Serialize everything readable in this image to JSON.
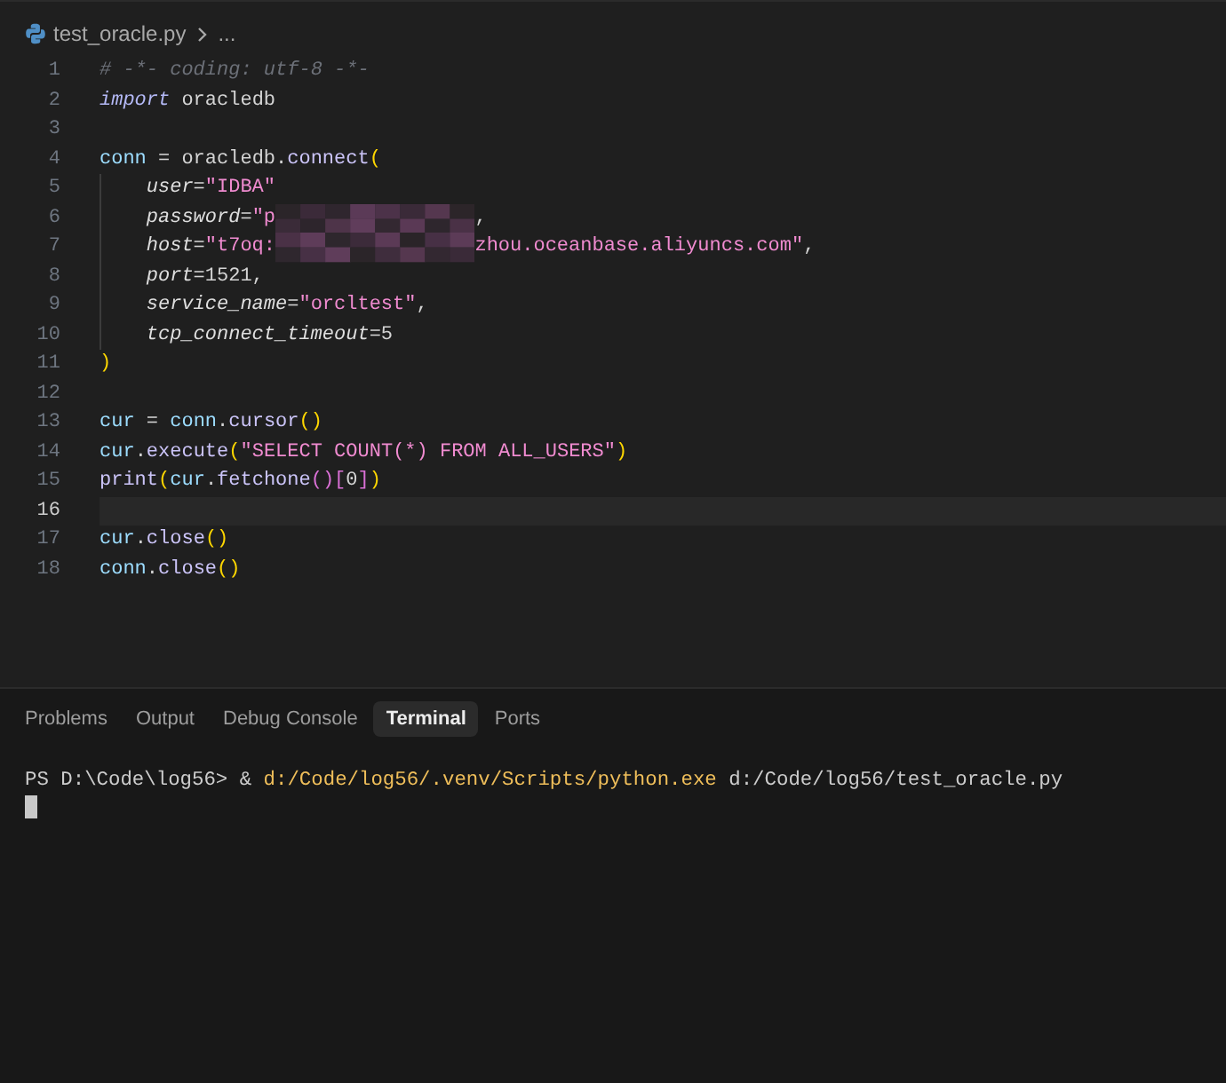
{
  "breadcrumb": {
    "file": "test_oracle.py",
    "more": "..."
  },
  "code": {
    "lines": [
      {
        "number": "1",
        "current": false,
        "tokens": [
          {
            "kind": "comment",
            "text": "# -*- coding: utf-8 -*-"
          }
        ]
      },
      {
        "number": "2",
        "current": false,
        "tokens": [
          {
            "kind": "keyword",
            "text": "import"
          },
          {
            "kind": "plain",
            "text": " oracledb"
          }
        ]
      },
      {
        "number": "3",
        "current": false
      },
      {
        "number": "4",
        "current": false,
        "tokens": [
          {
            "kind": "variable",
            "text": "conn"
          },
          {
            "kind": "plain",
            "text": " = oracledb."
          },
          {
            "kind": "function",
            "text": "connect"
          },
          {
            "kind": "bracket",
            "text": "("
          }
        ],
        "children": [
          {
            "number": "5",
            "current": false,
            "tokens": [
              {
                "kind": "param",
                "text": "user"
              },
              {
                "kind": "plain",
                "text": "="
              },
              {
                "kind": "string",
                "text": "\"IDBA\""
              }
            ]
          },
          {
            "number": "6",
            "current": false,
            "tokens": [
              {
                "kind": "param",
                "text": "password"
              },
              {
                "kind": "plain",
                "text": "="
              },
              {
                "kind": "string",
                "text": "\"p"
              },
              {
                "kind": "redacted"
              },
              {
                "kind": "plain",
                "text": ","
              }
            ]
          },
          {
            "number": "7",
            "current": false,
            "tokens": [
              {
                "kind": "param",
                "text": "host"
              },
              {
                "kind": "plain",
                "text": "="
              },
              {
                "kind": "string",
                "text": "\"t7oq:"
              },
              {
                "kind": "redacted"
              },
              {
                "kind": "string",
                "text": "zhou.oceanbase.aliyuncs.com\""
              },
              {
                "kind": "plain",
                "text": ","
              }
            ]
          },
          {
            "number": "8",
            "current": false,
            "tokens": [
              {
                "kind": "param",
                "text": "port"
              },
              {
                "kind": "plain",
                "text": "=1521,"
              }
            ]
          },
          {
            "number": "9",
            "current": false,
            "tokens": [
              {
                "kind": "param",
                "text": "service_name"
              },
              {
                "kind": "plain",
                "text": "="
              },
              {
                "kind": "string",
                "text": "\"orcltest\""
              },
              {
                "kind": "plain",
                "text": ","
              }
            ]
          },
          {
            "number": "10",
            "current": false,
            "tokens": [
              {
                "kind": "param",
                "text": "tcp_connect_timeout"
              },
              {
                "kind": "plain",
                "text": "=5"
              }
            ]
          }
        ]
      },
      {
        "number": "11",
        "current": false,
        "tokens": [
          {
            "kind": "bracket",
            "text": ")"
          }
        ]
      },
      {
        "number": "12",
        "current": false
      },
      {
        "number": "13",
        "current": false,
        "tokens": [
          {
            "kind": "variable",
            "text": "cur"
          },
          {
            "kind": "plain",
            "text": " = "
          },
          {
            "kind": "variable",
            "text": "conn"
          },
          {
            "kind": "plain",
            "text": "."
          },
          {
            "kind": "function",
            "text": "cursor"
          },
          {
            "kind": "bracket",
            "text": "()"
          }
        ]
      },
      {
        "number": "14",
        "current": false,
        "tokens": [
          {
            "kind": "variable",
            "text": "cur"
          },
          {
            "kind": "plain",
            "text": "."
          },
          {
            "kind": "function",
            "text": "execute"
          },
          {
            "kind": "bracket",
            "text": "("
          },
          {
            "kind": "string",
            "text": "\"SELECT COUNT(*) FROM ALL_USERS\""
          },
          {
            "kind": "bracket",
            "text": ")"
          }
        ]
      },
      {
        "number": "15",
        "current": false,
        "tokens": [
          {
            "kind": "function",
            "text": "print"
          },
          {
            "kind": "bracket",
            "text": "("
          },
          {
            "kind": "variable",
            "text": "cur"
          },
          {
            "kind": "plain",
            "text": "."
          },
          {
            "kind": "function",
            "text": "fetchone"
          },
          {
            "kind": "bracket2",
            "text": "()["
          },
          {
            "kind": "plain",
            "text": "0"
          },
          {
            "kind": "bracket2",
            "text": "]"
          },
          {
            "kind": "bracket",
            "text": ")"
          }
        ]
      },
      {
        "number": "16",
        "current": true
      },
      {
        "number": "17",
        "current": false,
        "tokens": [
          {
            "kind": "variable",
            "text": "cur"
          },
          {
            "kind": "plain",
            "text": "."
          },
          {
            "kind": "function",
            "text": "close"
          },
          {
            "kind": "bracket",
            "text": "()"
          }
        ]
      },
      {
        "number": "18",
        "current": false,
        "tokens": [
          {
            "kind": "variable",
            "text": "conn"
          },
          {
            "kind": "plain",
            "text": "."
          },
          {
            "kind": "function",
            "text": "close"
          },
          {
            "kind": "bracket",
            "text": "()"
          }
        ]
      }
    ]
  },
  "panel": {
    "tabs": [
      {
        "label": "Problems",
        "selected": false
      },
      {
        "label": "Output",
        "selected": false
      },
      {
        "label": "Debug Console",
        "selected": false
      },
      {
        "label": "Terminal",
        "selected": true
      },
      {
        "label": "Ports",
        "selected": false
      }
    ],
    "terminal": {
      "lines": [
        {
          "segments": [
            {
              "kind": "plain",
              "text": "PS D:\\Code\\log56> & "
            },
            {
              "kind": "command",
              "text": "d:/Code/log56/.venv/Scripts/python.exe"
            },
            {
              "kind": "plain",
              "text": " d:/Code/log56/test_oracle.py"
            }
          ]
        }
      ]
    }
  }
}
